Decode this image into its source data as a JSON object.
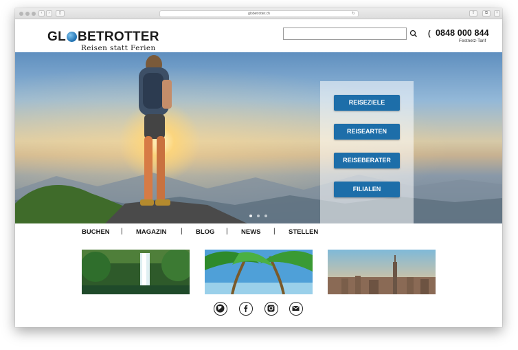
{
  "browser": {
    "url": "globetrotter.ch"
  },
  "header": {
    "search_placeholder": "",
    "phone": "0848 000 844",
    "phone_sub": "Festnetz-Tarif"
  },
  "logo": {
    "text_before": "GL",
    "text_after": "BETROTTER",
    "tagline": "Reisen statt Ferien"
  },
  "hero": {
    "buttons": [
      "REISEZIELE",
      "REISEARTEN",
      "REISEBERATER",
      "FILIALEN"
    ],
    "slides_count": 3
  },
  "nav": {
    "items": [
      "BUCHEN",
      "MAGAZIN",
      "BLOG",
      "NEWS",
      "STELLEN"
    ],
    "separator": "|"
  },
  "thumbnails": [
    "waterfall",
    "palm-beach",
    "new-york-skyline"
  ],
  "social": [
    "globe-icon",
    "facebook-icon",
    "instagram-icon",
    "mail-icon"
  ],
  "colors": {
    "accent": "#1d6ea9",
    "text": "#1b1b1b"
  }
}
